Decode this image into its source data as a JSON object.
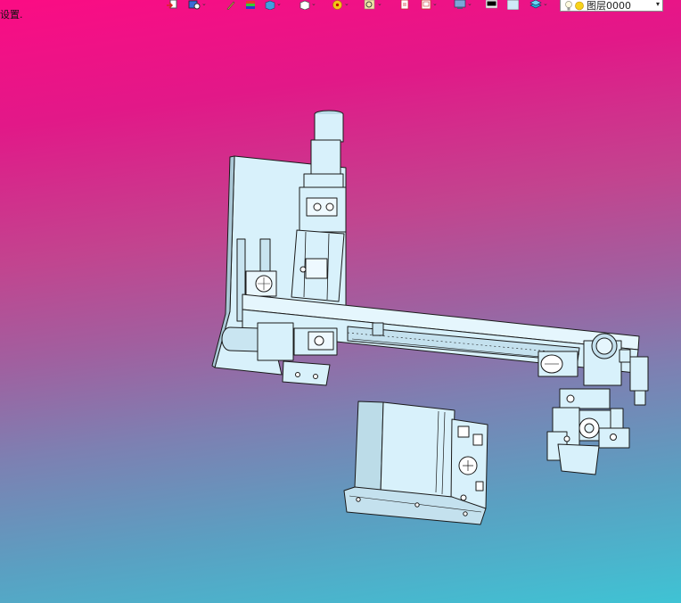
{
  "status_text": "设置.",
  "toolbar": {
    "icons": [
      "exit-icon",
      "model-icon",
      "pencil-icon",
      "layers-color-icon",
      "cube-icon",
      "box-icon",
      "star-icon",
      "magnify-icon",
      "page-icon",
      "frame-icon",
      "display-icon",
      "color-swatch-icon",
      "color-box-icon",
      "layer-stack-icon"
    ],
    "layer_combo": {
      "icons": [
        "lightbulb-icon",
        "sun-icon"
      ],
      "value": "图层0000"
    }
  },
  "colors": {
    "background_top": "#fb0c84",
    "background_bottom": "#3fc3d4",
    "part_fill": "#d8f1fb",
    "part_outline": "#1a1a1a"
  }
}
